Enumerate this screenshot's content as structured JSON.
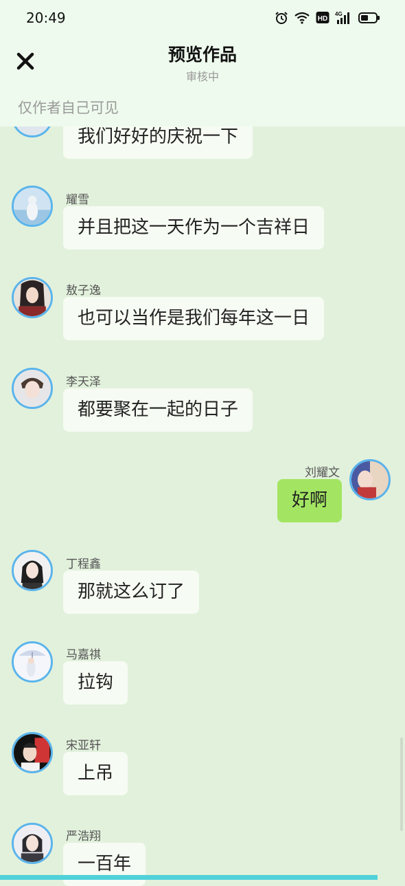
{
  "status_bar": {
    "time": "20:49",
    "network_label": "4G",
    "hd_label": "HD"
  },
  "header": {
    "title": "预览作品",
    "subtitle": "审核中",
    "visibility_note": "仅作者自己可见"
  },
  "messages": [
    {
      "name": "",
      "text": "我们好好的庆祝一下",
      "side": "left"
    },
    {
      "name": "耀雪",
      "text": "并且把这一天作为一个吉祥日",
      "side": "left"
    },
    {
      "name": "敖子逸",
      "text": "也可以当作是我们每年这一日",
      "side": "left"
    },
    {
      "name": "李天泽",
      "text": "都要聚在一起的日子",
      "side": "left"
    },
    {
      "name": "刘耀文",
      "text": "好啊",
      "side": "right"
    },
    {
      "name": "丁程鑫",
      "text": "那就这么订了",
      "side": "left"
    },
    {
      "name": "马嘉祺",
      "text": "拉钩",
      "side": "left"
    },
    {
      "name": "宋亚轩",
      "text": "上吊",
      "side": "left"
    },
    {
      "name": "严浩翔",
      "text": "一百年",
      "side": "left"
    }
  ],
  "colors": {
    "background": "#e2f1dc",
    "header": "#eefaed",
    "bubble_other": "#f6fbf3",
    "bubble_self": "#a3e562",
    "avatar_border": "#5ab4ec",
    "bottom_bar": "#50d1d9"
  }
}
